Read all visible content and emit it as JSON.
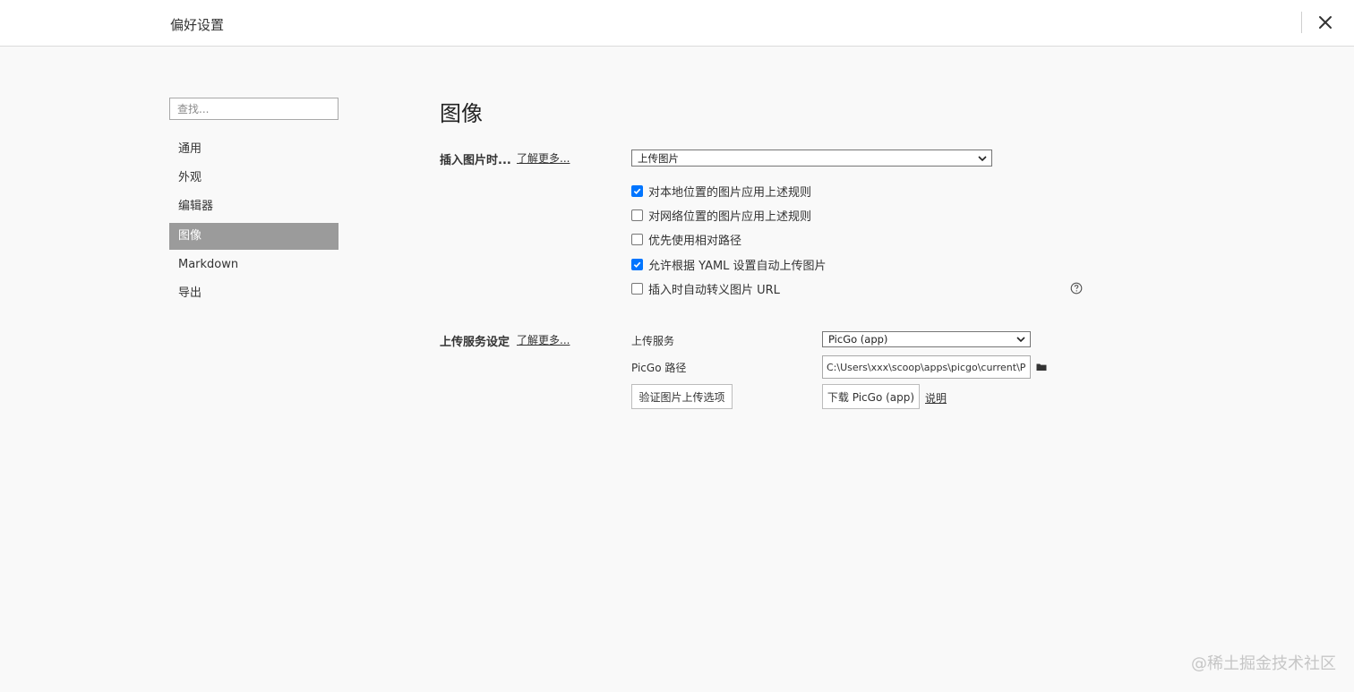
{
  "window": {
    "title": "偏好设置",
    "close_icon": "close-icon"
  },
  "sidebar": {
    "search_placeholder": "查找...",
    "items": [
      {
        "label": "通用",
        "active": false
      },
      {
        "label": "外观",
        "active": false
      },
      {
        "label": "编辑器",
        "active": false
      },
      {
        "label": "图像",
        "active": true
      },
      {
        "label": "Markdown",
        "active": false
      },
      {
        "label": "导出",
        "active": false
      }
    ]
  },
  "main": {
    "title": "图像",
    "insert": {
      "label": "插入图片时...",
      "learn_more": "了解更多...",
      "action_selected": "上传图片",
      "options": [
        {
          "label": "对本地位置的图片应用上述规则",
          "checked": true
        },
        {
          "label": "对网络位置的图片应用上述规则",
          "checked": false
        },
        {
          "label": "优先使用相对路径",
          "checked": false
        },
        {
          "label": "允许根据 YAML 设置自动上传图片",
          "checked": true
        },
        {
          "label": "插入时自动转义图片 URL",
          "checked": false
        }
      ],
      "help_icon": "question-circle-icon"
    },
    "upload": {
      "label": "上传服务设定",
      "learn_more": "了解更多...",
      "service_label": "上传服务",
      "service_selected": "PicGo (app)",
      "path_label": "PicGo 路径",
      "path_value": "C:\\Users\\xxx\\scoop\\apps\\picgo\\current\\PicGo.exe",
      "folder_icon": "folder-icon",
      "verify_button": "验证图片上传选项",
      "download_button": "下载 PicGo (app)",
      "description_link": "说明"
    }
  },
  "watermark": "@稀土掘金技术社区",
  "colors": {
    "accent": "#0075ff",
    "active_nav": "#9b9b9b",
    "background": "#f9f9f9"
  }
}
